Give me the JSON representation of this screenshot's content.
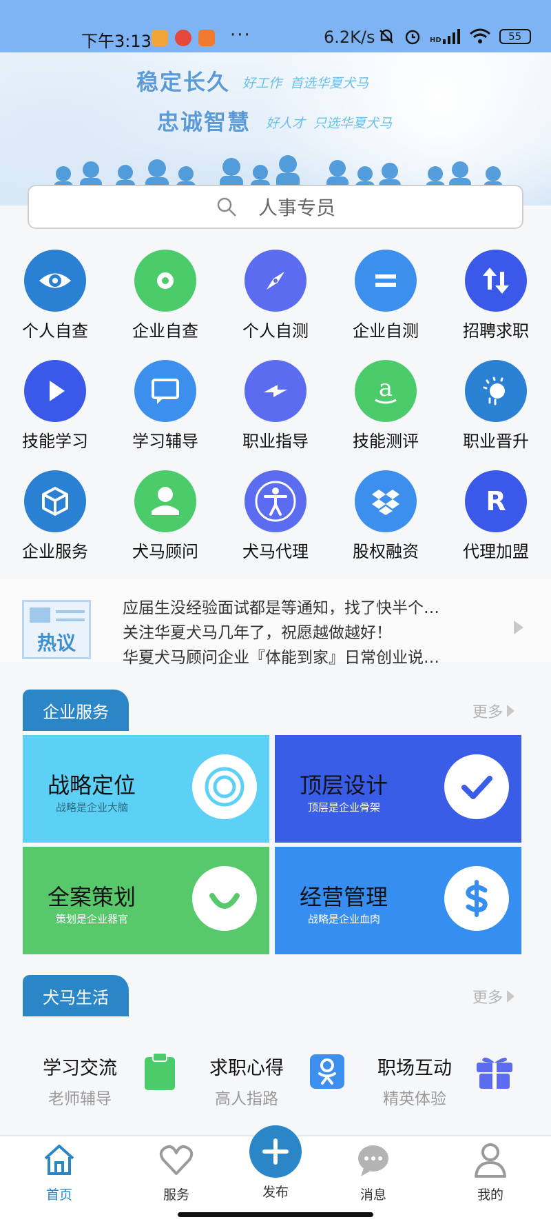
{
  "status_bar": {
    "time": "下午3:13",
    "dots": "···",
    "network_speed": "6.2K/s",
    "network_type": "HD",
    "battery": "55"
  },
  "banner": {
    "slogan1": "稳定长久",
    "slogan1_sub": "好工作  首选华夏犬马",
    "slogan2": "忠诚智慧",
    "slogan2_sub": "好人才  只选华夏犬马"
  },
  "search": {
    "placeholder": "人事专员"
  },
  "grid": [
    {
      "label": "个人自查",
      "icon": "eye-icon",
      "color": "#2a80d2"
    },
    {
      "label": "企业自查",
      "icon": "disc-icon",
      "color": "#4ccb6a"
    },
    {
      "label": "个人自测",
      "icon": "compass-icon",
      "color": "#5b6cf0"
    },
    {
      "label": "企业自测",
      "icon": "equals-icon",
      "color": "#3d8fee"
    },
    {
      "label": "招聘求职",
      "icon": "swap-arrows-icon",
      "color": "#3a59e8"
    },
    {
      "label": "技能学习",
      "icon": "play-icon",
      "color": "#3a59e8"
    },
    {
      "label": "学习辅导",
      "icon": "message-icon",
      "color": "#3d8fee"
    },
    {
      "label": "职业指导",
      "icon": "lightning-icon",
      "color": "#5b6cf0"
    },
    {
      "label": "技能测评",
      "icon": "amazon-icon",
      "color": "#4ccb6a"
    },
    {
      "label": "职业晋升",
      "icon": "sun-icon",
      "color": "#2a80d2"
    },
    {
      "label": "企业服务",
      "icon": "box-icon",
      "color": "#2a80d2"
    },
    {
      "label": "犬马顾问",
      "icon": "user-icon",
      "color": "#4ccb6a"
    },
    {
      "label": "犬马代理",
      "icon": "accessibility-icon",
      "color": "#5b6cf0"
    },
    {
      "label": "股权融资",
      "icon": "dropbox-icon",
      "color": "#3d8fee"
    },
    {
      "label": "代理加盟",
      "icon": "letter-r-icon",
      "color": "#3a59e8"
    }
  ],
  "hot": {
    "badge": "热议",
    "items": [
      "应届生没经验面试都是等通知，找了快半个…",
      "关注华夏犬马几年了，祝愿越做越好！",
      "华夏犬马顾问企业『体能到家』日常创业说…"
    ]
  },
  "enterprise": {
    "title": "企业服务",
    "more": "更多",
    "tiles": [
      {
        "title": "战略定位",
        "sub": "战略是企业大脑",
        "bg": "#5cd1f5",
        "fg": "#111",
        "subfg": "#2a6a80",
        "icon": "target-icon",
        "icon_color": "#5cd1f5"
      },
      {
        "title": "顶层设计",
        "sub": "顶层是企业骨架",
        "bg": "#3a5de8",
        "fg": "#111",
        "subfg": "#ffffff",
        "icon": "check-icon",
        "icon_color": "#3a5de8"
      },
      {
        "title": "全案策划",
        "sub": "策划是企业器官",
        "bg": "#57c96a",
        "fg": "#111",
        "subfg": "#ffffff",
        "icon": "smile-icon",
        "icon_color": "#57c96a"
      },
      {
        "title": "经营管理",
        "sub": "战略是企业血肉",
        "bg": "#368ef0",
        "fg": "#111",
        "subfg": "#ffffff",
        "icon": "dollar-icon",
        "icon_color": "#368ef0"
      }
    ]
  },
  "life": {
    "title": "犬马生活",
    "more": "更多",
    "items": [
      {
        "title": "学习交流",
        "sub": "老师辅导",
        "icon": "clipboard-icon",
        "color": "#4ccb6a"
      },
      {
        "title": "求职心得",
        "sub": "高人指路",
        "icon": "odnoklassniki-icon",
        "color": "#3d8fee"
      },
      {
        "title": "职场互动",
        "sub": "精英体验",
        "icon": "gift-icon",
        "color": "#5b6cf0"
      }
    ]
  },
  "nav": {
    "home": "首页",
    "service": "服务",
    "publish": "发布",
    "messages": "消息",
    "mine": "我的"
  }
}
